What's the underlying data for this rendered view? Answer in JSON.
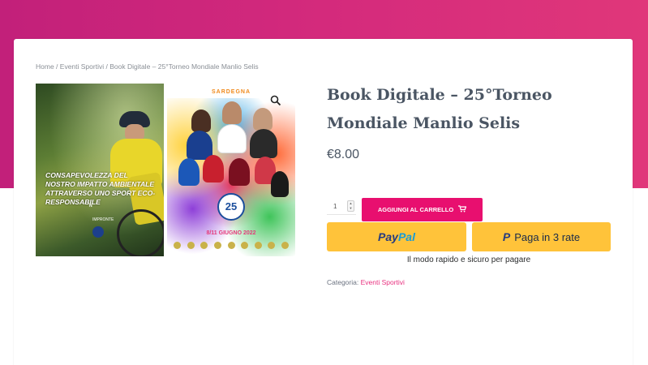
{
  "breadcrumb": {
    "home": "Home",
    "sep1": " / ",
    "category": "Eventi Sportivi",
    "sep2": " / ",
    "current": "Book Digitale – 25°Torneo Mondiale Manlio Selis"
  },
  "gallery": {
    "left_caption": "Consapevolezza del nostro impatto ambientale attraverso uno sport eco-responsabile",
    "left_small": "N",
    "left_small2": "IMPRONTE",
    "right_header": "SARDEGNA",
    "right_badge": "25",
    "right_dates": "8/11 GIUGNO 2022",
    "zoom_icon": "search-icon"
  },
  "product": {
    "title": "Book Digitale – 25°Torneo Mondiale Manlio Selis",
    "price": "€8.00",
    "quantity": "1",
    "add_to_cart_label": "Aggiungi al carrello",
    "add_to_cart_icon": "cart-icon"
  },
  "payment": {
    "paypal_part1": "Pay",
    "paypal_part2": "Pal",
    "payin3_label": "Paga in 3 rate",
    "payin3_mark": "P",
    "note": "Il modo rapido e sicuro per pagare"
  },
  "meta": {
    "category_label": "Categoria: ",
    "category_value": "Eventi Sportivi"
  },
  "colors": {
    "accent": "#e80f6f",
    "hero_gradient_start": "#c2207a",
    "hero_gradient_end": "#e0377a",
    "paypal_yellow": "#ffc33a",
    "title": "#4a5563"
  }
}
